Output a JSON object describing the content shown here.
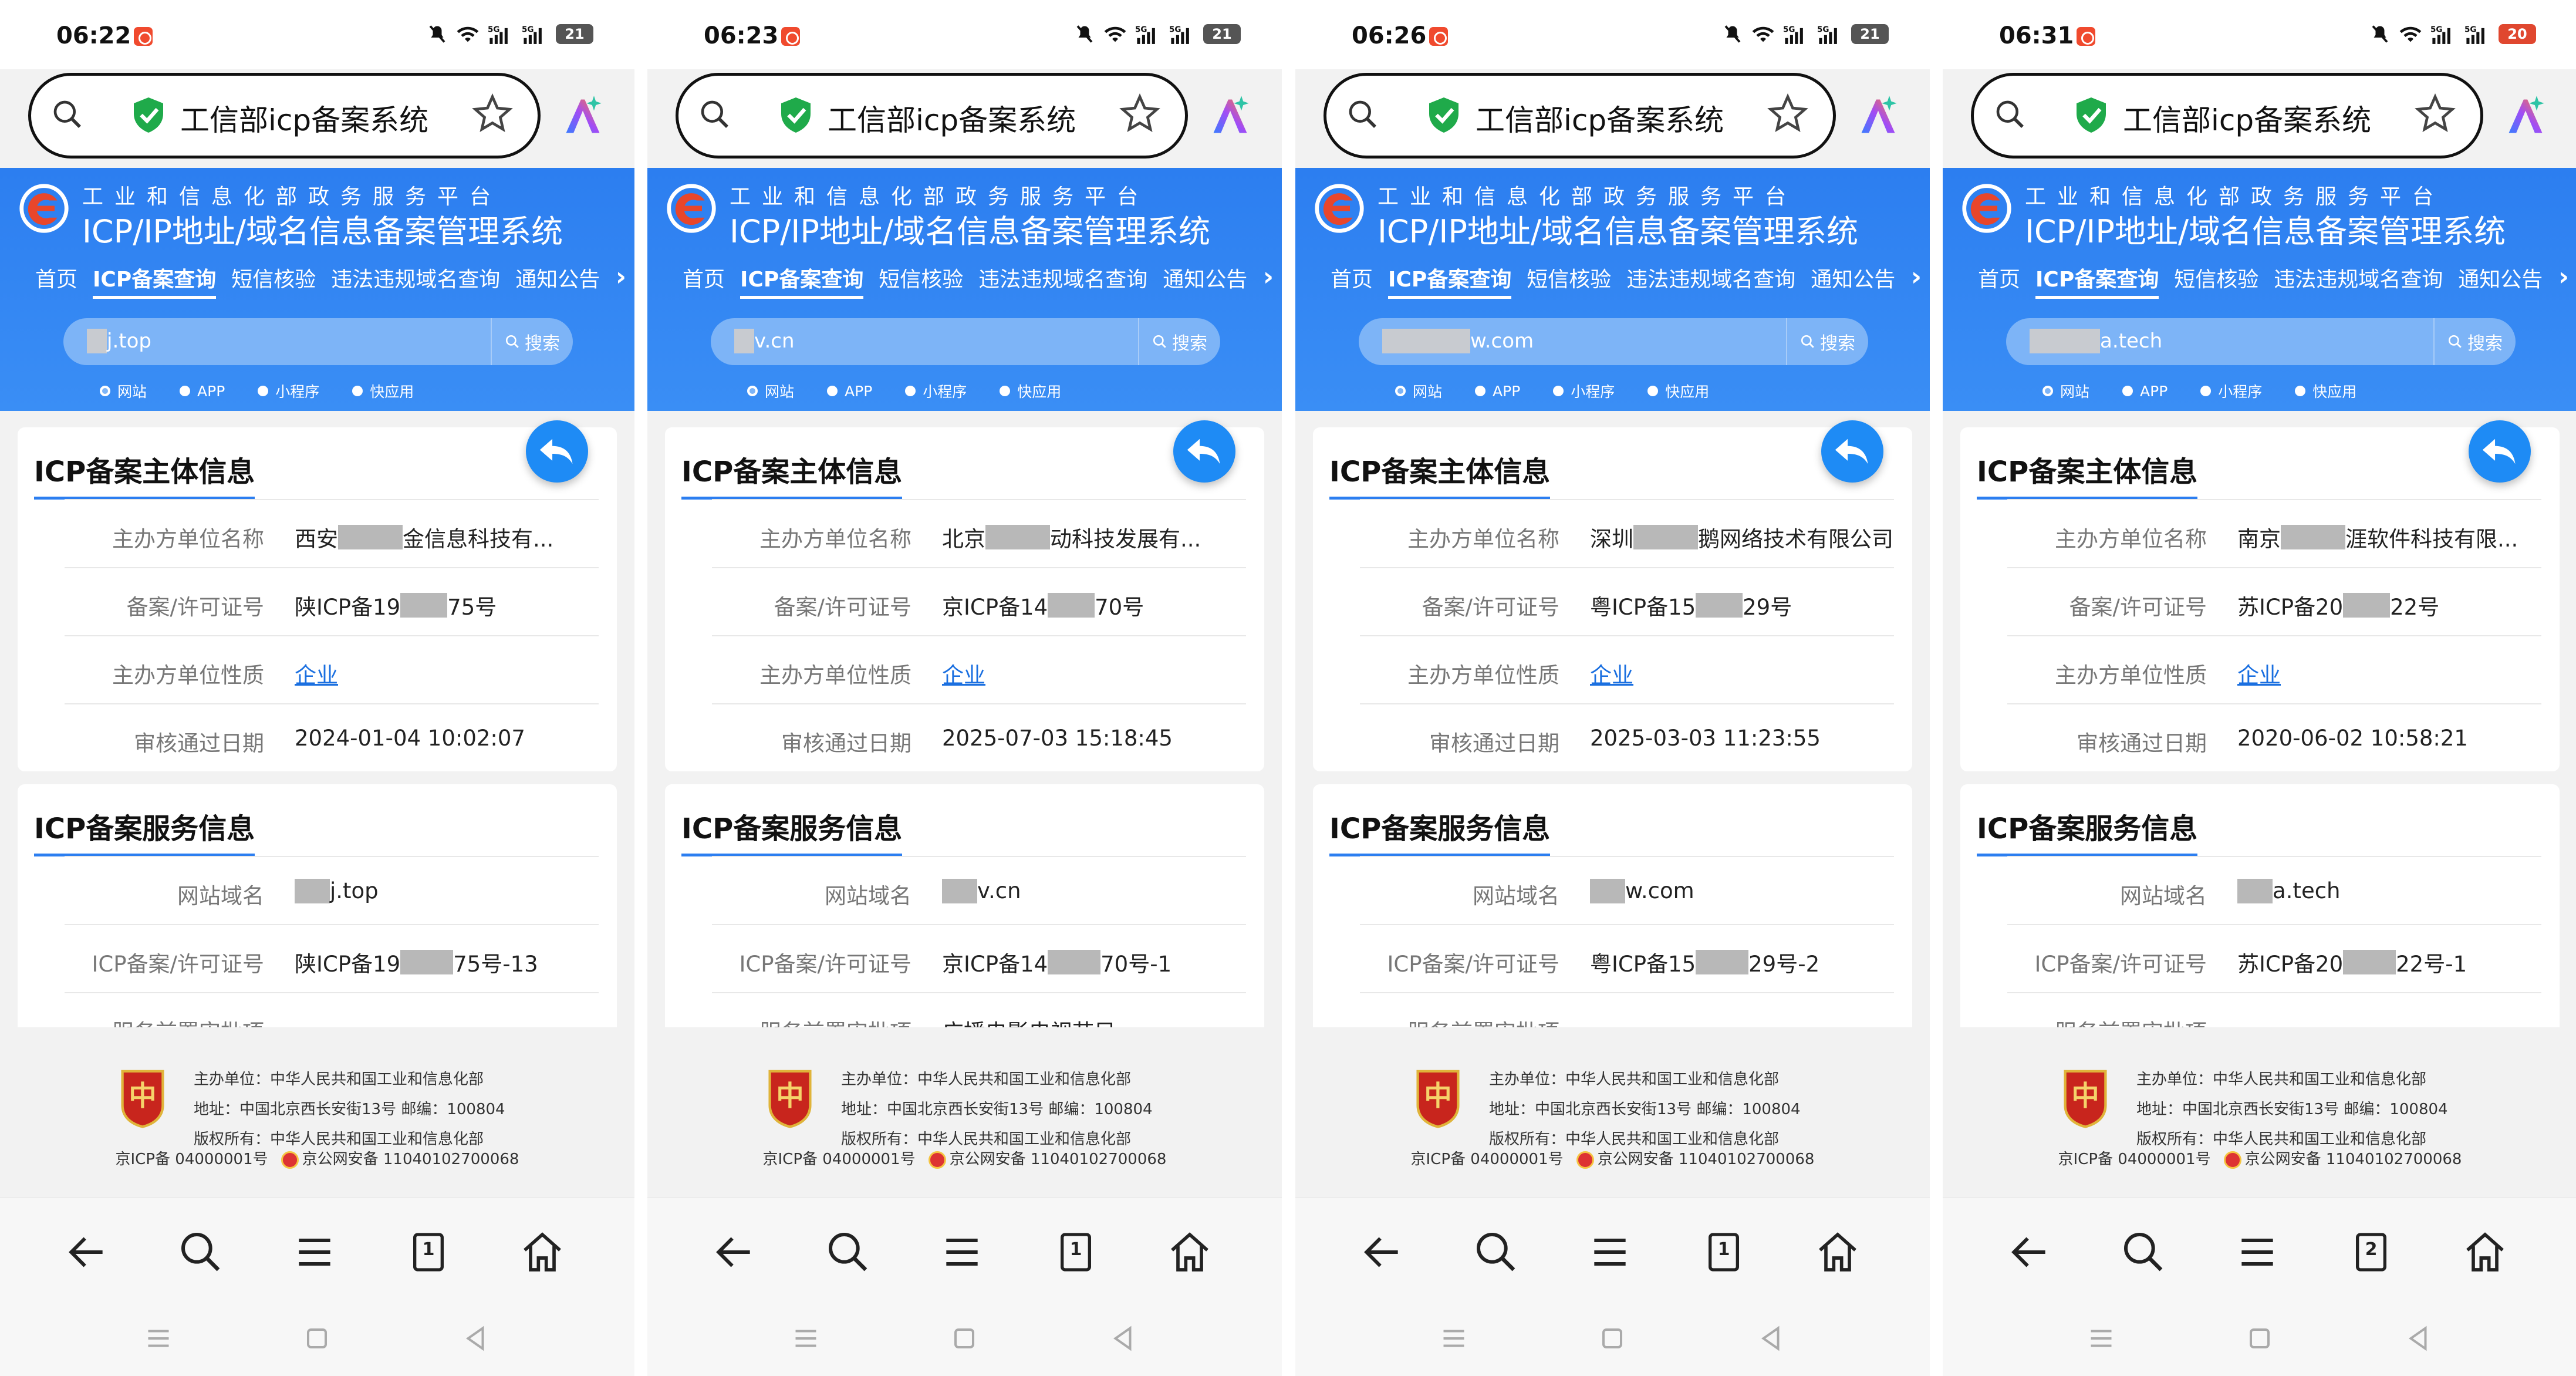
{
  "common": {
    "url_text": "工信部icp备案系统",
    "site_subtitle": "工业和信息化部政务服务平台",
    "site_title": "ICP/IP地址/域名信息备案管理系统",
    "nav": [
      "首页",
      "ICP备案查询",
      "短信核验",
      "违法违规域名查询",
      "通知公告"
    ],
    "nav_more": "›",
    "search_button": "搜索",
    "radios": [
      "网站",
      "APP",
      "小程序",
      "快应用"
    ],
    "card1_title": "ICP备案主体信息",
    "card2_title": "ICP备案服务信息",
    "labels": {
      "org_name": "主办方单位名称",
      "license": "备案/许可证号",
      "org_type": "主办方单位性质",
      "approval_date": "审核通过日期",
      "domain": "网站域名",
      "icp_license": "ICP备案/许可证号",
      "pre_approval": "服务前置审批项"
    },
    "footer": {
      "sponsor": "主办单位：中华人民共和国工业和信息化部",
      "address": "地址：中国北京西长安街13号 邮编：100804",
      "copyright": "版权所有：中华人民共和国工业和信息化部",
      "icp": "京ICP备 04000001号",
      "police": "京公网安备 11040102700068"
    },
    "colors": {
      "brand_blue": "#2c7ef0",
      "link": "#1a6fe0",
      "fab": "#1e8bf5"
    }
  },
  "phones": [
    {
      "time": "06:22",
      "battery": "21",
      "search_suffix": "j.top",
      "org_name_a": "西安",
      "org_name_b": "金信息科技有...",
      "license_a": "陕ICP备19",
      "license_b": "75号",
      "org_type": "企业",
      "approval_date": "2024-01-04 10:02:07",
      "domain_b": "j.top",
      "icp_license_a": "陕ICP备19",
      "icp_license_b": "75号-13",
      "pre_approval": "",
      "tabs": "1"
    },
    {
      "time": "06:23",
      "battery": "21",
      "search_suffix": "v.cn",
      "org_name_a": "北京",
      "org_name_b": "动科技发展有...",
      "license_a": "京ICP备14",
      "license_b": "70号",
      "org_type": "企业",
      "approval_date": "2025-07-03 15:18:45",
      "domain_b": "v.cn",
      "icp_license_a": "京ICP备14",
      "icp_license_b": "70号-1",
      "pre_approval": "广播电影电视节目",
      "tabs": "1"
    },
    {
      "time": "06:26",
      "battery": "21",
      "search_suffix": "w.com",
      "org_name_a": "深圳",
      "org_name_b": "鹅网络技术有限公司",
      "license_a": "粤ICP备15",
      "license_b": "29号",
      "org_type": "企业",
      "approval_date": "2025-03-03 11:23:55",
      "domain_b": "w.com",
      "icp_license_a": "粤ICP备15",
      "icp_license_b": "29号-2",
      "pre_approval": "",
      "tabs": "1"
    },
    {
      "time": "06:31",
      "battery": "20",
      "search_suffix": "a.tech",
      "org_name_a": "南京",
      "org_name_b": "涯软件科技有限...",
      "license_a": "苏ICP备20",
      "license_b": "22号",
      "org_type": "企业",
      "approval_date": "2020-06-02 10:58:21",
      "domain_b": "a.tech",
      "icp_license_a": "苏ICP备20",
      "icp_license_b": "22号-1",
      "pre_approval": "",
      "tabs": "2"
    }
  ]
}
